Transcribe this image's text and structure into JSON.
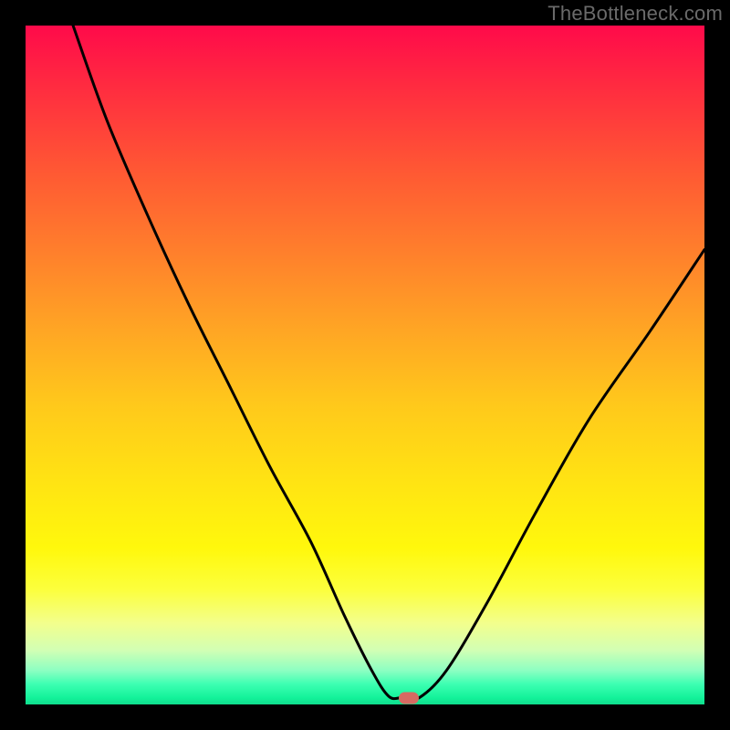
{
  "watermark": "TheBottleneck.com",
  "colors": {
    "page_bg": "#000000",
    "watermark_text": "#6a6a6a",
    "curve": "#000000",
    "marker": "#d66a62"
  },
  "chart_data": {
    "type": "line",
    "title": "",
    "xlabel": "",
    "ylabel": "",
    "xlim": [
      0,
      100
    ],
    "ylim": [
      0,
      100
    ],
    "grid": false,
    "legend": false,
    "gradient_stops": [
      {
        "pos": 0,
        "hex": "#ff0a4a"
      },
      {
        "pos": 10,
        "hex": "#ff2f3f"
      },
      {
        "pos": 22,
        "hex": "#ff5a33"
      },
      {
        "pos": 33,
        "hex": "#ff7e2c"
      },
      {
        "pos": 45,
        "hex": "#ffa624"
      },
      {
        "pos": 56,
        "hex": "#ffc91b"
      },
      {
        "pos": 67,
        "hex": "#ffe313"
      },
      {
        "pos": 77,
        "hex": "#fff80c"
      },
      {
        "pos": 83,
        "hex": "#fcff3c"
      },
      {
        "pos": 88,
        "hex": "#f3ff8c"
      },
      {
        "pos": 92,
        "hex": "#d2ffb4"
      },
      {
        "pos": 95,
        "hex": "#8cffc2"
      },
      {
        "pos": 97,
        "hex": "#3dffb2"
      },
      {
        "pos": 99,
        "hex": "#13f29a"
      },
      {
        "pos": 100,
        "hex": "#0fdd8d"
      }
    ],
    "series": [
      {
        "name": "bottleneck-curve",
        "x": [
          7,
          12,
          18,
          24,
          30,
          36,
          42,
          47,
          51,
          53.5,
          55.5,
          58,
          62,
          68,
          75,
          83,
          92,
          100
        ],
        "y": [
          100,
          86,
          72,
          59,
          47,
          35,
          24,
          13,
          5,
          1.2,
          1.0,
          1.0,
          5,
          15,
          28,
          42,
          55,
          67
        ]
      }
    ],
    "marker": {
      "x": 56.5,
      "y": 1.0
    }
  }
}
